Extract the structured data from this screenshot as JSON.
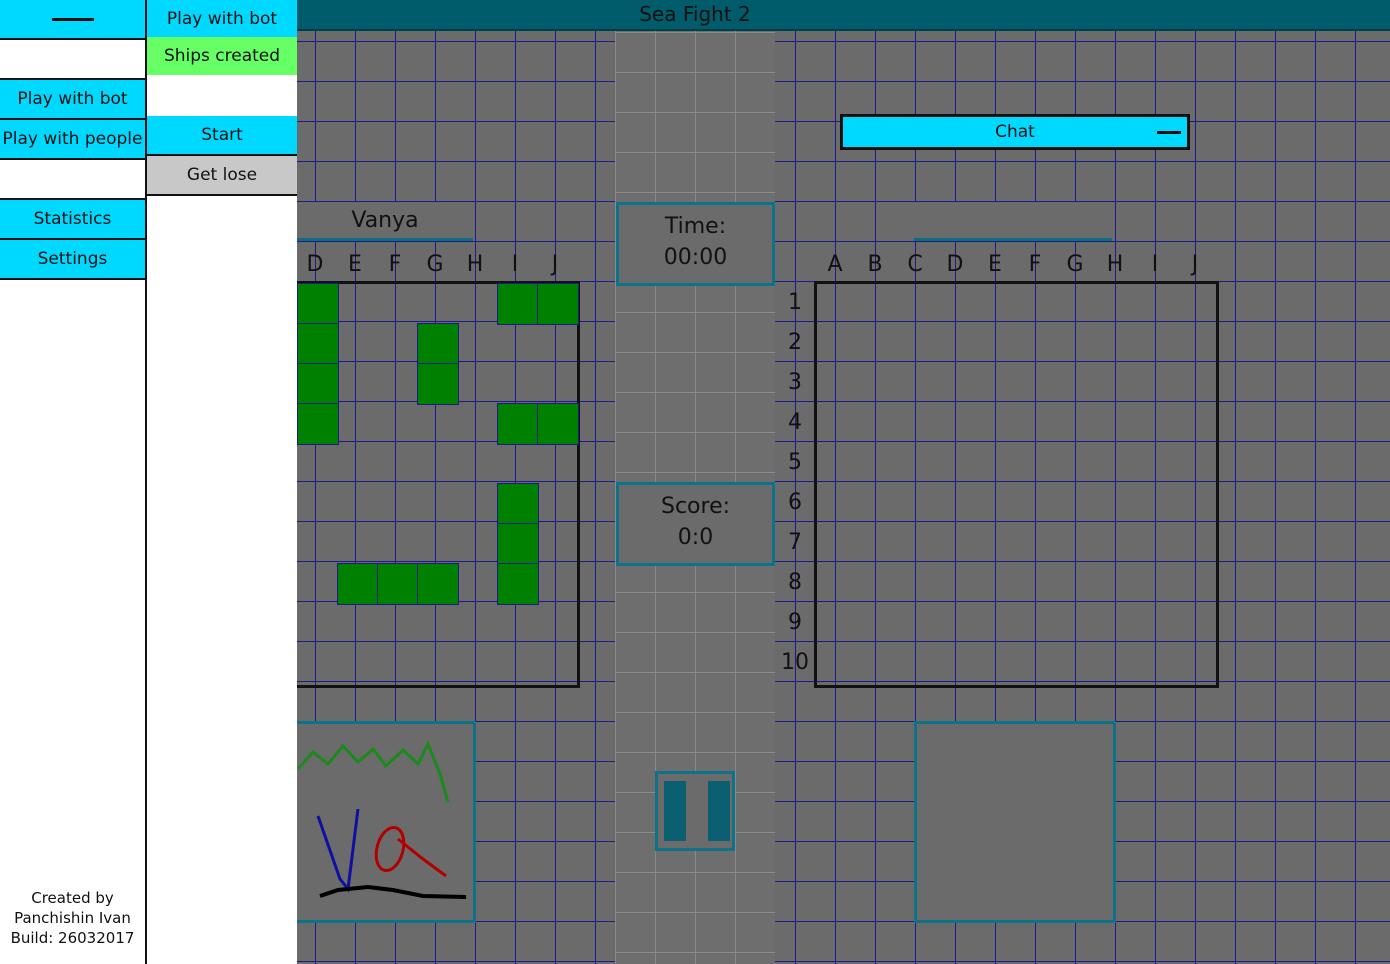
{
  "window": {
    "title": "Sea Fight 2"
  },
  "menu_primary": {
    "toggle_label": "—",
    "play_bot": "Play with bot",
    "play_people": "Play with people",
    "statistics": "Statistics",
    "settings": "Settings",
    "credits_line1": "Created by",
    "credits_line2": "Panchishin Ivan",
    "credits_line3": "Build: 26032017"
  },
  "menu_secondary": {
    "mode_title": "Play with bot",
    "ships_status": "Ships created",
    "start": "Start",
    "get_lose": "Get lose"
  },
  "player": {
    "name": "Vanya",
    "visible_columns": [
      "D",
      "E",
      "F",
      "G",
      "H",
      "I",
      "J"
    ],
    "ships": [
      [
        "D",
        1
      ],
      [
        "D",
        2
      ],
      [
        "D",
        3
      ],
      [
        "D",
        4
      ],
      [
        "I",
        1
      ],
      [
        "J",
        1
      ],
      [
        "G",
        2
      ],
      [
        "G",
        3
      ],
      [
        "I",
        4
      ],
      [
        "J",
        4
      ],
      [
        "I",
        6
      ],
      [
        "I",
        7
      ],
      [
        "I",
        8
      ],
      [
        "E",
        8
      ],
      [
        "F",
        8
      ],
      [
        "G",
        8
      ]
    ]
  },
  "opponent": {
    "name": "",
    "columns": [
      "A",
      "B",
      "C",
      "D",
      "E",
      "F",
      "G",
      "H",
      "I",
      "J"
    ],
    "rows": [
      "1",
      "2",
      "3",
      "4",
      "5",
      "6",
      "7",
      "8",
      "9",
      "10"
    ]
  },
  "status": {
    "time_label": "Time:",
    "time_value": "00:00",
    "score_label": "Score:",
    "score_value": "0:0"
  },
  "chat": {
    "label": "Chat"
  },
  "colors": {
    "accent": "#00d9ff",
    "ship": "#008000",
    "header": "#005b6b",
    "ships_created": "#66ff66",
    "get_lose": "#c8c8c8"
  }
}
